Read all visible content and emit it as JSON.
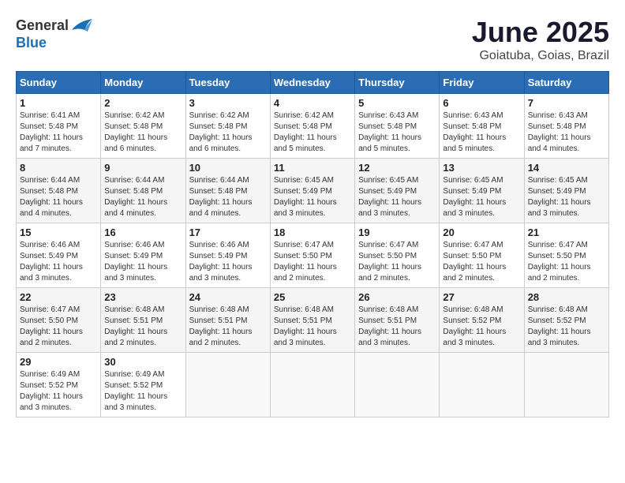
{
  "header": {
    "logo_general": "General",
    "logo_blue": "Blue",
    "month": "June 2025",
    "location": "Goiatuba, Goias, Brazil"
  },
  "days_of_week": [
    "Sunday",
    "Monday",
    "Tuesday",
    "Wednesday",
    "Thursday",
    "Friday",
    "Saturday"
  ],
  "weeks": [
    [
      {
        "day": "1",
        "sunrise": "6:41 AM",
        "sunset": "5:48 PM",
        "daylight": "11 hours and 7 minutes."
      },
      {
        "day": "2",
        "sunrise": "6:42 AM",
        "sunset": "5:48 PM",
        "daylight": "11 hours and 6 minutes."
      },
      {
        "day": "3",
        "sunrise": "6:42 AM",
        "sunset": "5:48 PM",
        "daylight": "11 hours and 6 minutes."
      },
      {
        "day": "4",
        "sunrise": "6:42 AM",
        "sunset": "5:48 PM",
        "daylight": "11 hours and 5 minutes."
      },
      {
        "day": "5",
        "sunrise": "6:43 AM",
        "sunset": "5:48 PM",
        "daylight": "11 hours and 5 minutes."
      },
      {
        "day": "6",
        "sunrise": "6:43 AM",
        "sunset": "5:48 PM",
        "daylight": "11 hours and 5 minutes."
      },
      {
        "day": "7",
        "sunrise": "6:43 AM",
        "sunset": "5:48 PM",
        "daylight": "11 hours and 4 minutes."
      }
    ],
    [
      {
        "day": "8",
        "sunrise": "6:44 AM",
        "sunset": "5:48 PM",
        "daylight": "11 hours and 4 minutes."
      },
      {
        "day": "9",
        "sunrise": "6:44 AM",
        "sunset": "5:48 PM",
        "daylight": "11 hours and 4 minutes."
      },
      {
        "day": "10",
        "sunrise": "6:44 AM",
        "sunset": "5:48 PM",
        "daylight": "11 hours and 4 minutes."
      },
      {
        "day": "11",
        "sunrise": "6:45 AM",
        "sunset": "5:49 PM",
        "daylight": "11 hours and 3 minutes."
      },
      {
        "day": "12",
        "sunrise": "6:45 AM",
        "sunset": "5:49 PM",
        "daylight": "11 hours and 3 minutes."
      },
      {
        "day": "13",
        "sunrise": "6:45 AM",
        "sunset": "5:49 PM",
        "daylight": "11 hours and 3 minutes."
      },
      {
        "day": "14",
        "sunrise": "6:45 AM",
        "sunset": "5:49 PM",
        "daylight": "11 hours and 3 minutes."
      }
    ],
    [
      {
        "day": "15",
        "sunrise": "6:46 AM",
        "sunset": "5:49 PM",
        "daylight": "11 hours and 3 minutes."
      },
      {
        "day": "16",
        "sunrise": "6:46 AM",
        "sunset": "5:49 PM",
        "daylight": "11 hours and 3 minutes."
      },
      {
        "day": "17",
        "sunrise": "6:46 AM",
        "sunset": "5:49 PM",
        "daylight": "11 hours and 3 minutes."
      },
      {
        "day": "18",
        "sunrise": "6:47 AM",
        "sunset": "5:50 PM",
        "daylight": "11 hours and 2 minutes."
      },
      {
        "day": "19",
        "sunrise": "6:47 AM",
        "sunset": "5:50 PM",
        "daylight": "11 hours and 2 minutes."
      },
      {
        "day": "20",
        "sunrise": "6:47 AM",
        "sunset": "5:50 PM",
        "daylight": "11 hours and 2 minutes."
      },
      {
        "day": "21",
        "sunrise": "6:47 AM",
        "sunset": "5:50 PM",
        "daylight": "11 hours and 2 minutes."
      }
    ],
    [
      {
        "day": "22",
        "sunrise": "6:47 AM",
        "sunset": "5:50 PM",
        "daylight": "11 hours and 2 minutes."
      },
      {
        "day": "23",
        "sunrise": "6:48 AM",
        "sunset": "5:51 PM",
        "daylight": "11 hours and 2 minutes."
      },
      {
        "day": "24",
        "sunrise": "6:48 AM",
        "sunset": "5:51 PM",
        "daylight": "11 hours and 2 minutes."
      },
      {
        "day": "25",
        "sunrise": "6:48 AM",
        "sunset": "5:51 PM",
        "daylight": "11 hours and 3 minutes."
      },
      {
        "day": "26",
        "sunrise": "6:48 AM",
        "sunset": "5:51 PM",
        "daylight": "11 hours and 3 minutes."
      },
      {
        "day": "27",
        "sunrise": "6:48 AM",
        "sunset": "5:52 PM",
        "daylight": "11 hours and 3 minutes."
      },
      {
        "day": "28",
        "sunrise": "6:48 AM",
        "sunset": "5:52 PM",
        "daylight": "11 hours and 3 minutes."
      }
    ],
    [
      {
        "day": "29",
        "sunrise": "6:49 AM",
        "sunset": "5:52 PM",
        "daylight": "11 hours and 3 minutes."
      },
      {
        "day": "30",
        "sunrise": "6:49 AM",
        "sunset": "5:52 PM",
        "daylight": "11 hours and 3 minutes."
      },
      null,
      null,
      null,
      null,
      null
    ]
  ]
}
